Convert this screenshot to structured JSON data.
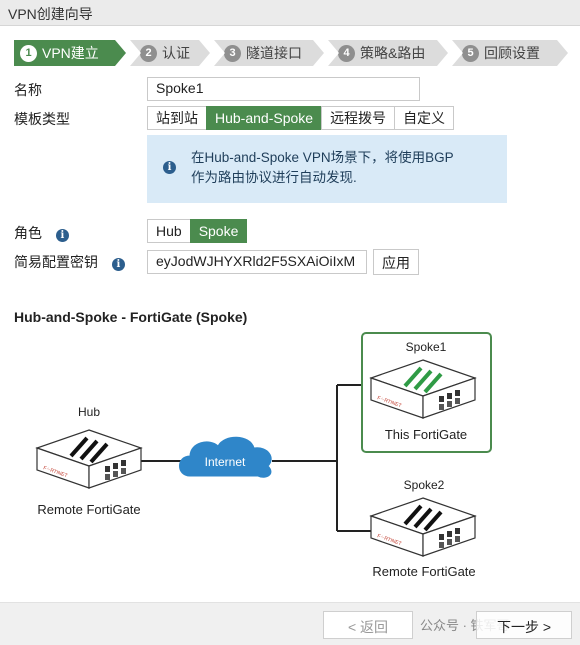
{
  "window": {
    "title": "VPN创建向导"
  },
  "steps": [
    {
      "num": "1",
      "label": "VPN建立"
    },
    {
      "num": "2",
      "label": "认证"
    },
    {
      "num": "3",
      "label": "隧道接口"
    },
    {
      "num": "4",
      "label": "策略&路由"
    },
    {
      "num": "5",
      "label": "回顾设置"
    }
  ],
  "form": {
    "name_label": "名称",
    "name_value": "Spoke1",
    "template_label": "模板类型",
    "template_options": [
      "站到站",
      "Hub-and-Spoke",
      "远程拨号",
      "自定义"
    ],
    "template_selected": "Hub-and-Spoke",
    "info_text_line1": "在Hub-and-Spoke VPN场景下，将使用BGP",
    "info_text_line2": "作为路由协议进行自动发现.",
    "role_label": "角色",
    "role_options": [
      "Hub",
      "Spoke"
    ],
    "role_selected": "Spoke",
    "key_label": "简易配置密钥",
    "key_value": "eyJodWJHYXRld2F5SXAiOiIxM",
    "apply_label": "应用"
  },
  "diagram": {
    "title": "Hub-and-Spoke - FortiGate (Spoke)",
    "hub_label": "Hub",
    "hub_caption": "Remote FortiGate",
    "internet_label": "Internet",
    "spoke1_label": "Spoke1",
    "spoke1_caption": "This FortiGate",
    "spoke2_label": "Spoke2",
    "spoke2_caption": "Remote FortiGate",
    "brand": "F⁘RTINET",
    "highlight_color": "#4b8b4e"
  },
  "footer": {
    "back_label": "< 返回",
    "next_label": "下一步 >",
    "watermark": "公众号 · 铁军哥"
  }
}
